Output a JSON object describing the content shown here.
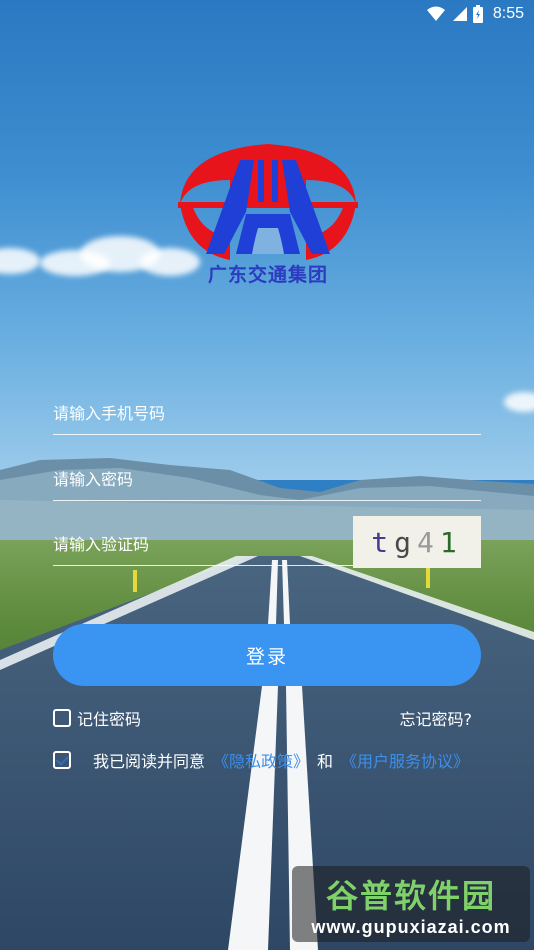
{
  "status_bar": {
    "time": "8:55",
    "icons": [
      "wifi-icon",
      "cell-signal-icon",
      "battery-icon"
    ]
  },
  "logo": {
    "text": "广东交通集团",
    "colors": {
      "ring": "#e8141b",
      "road": "#1f3fd6"
    }
  },
  "form": {
    "phone_placeholder": "请输入手机号码",
    "password_placeholder": "请输入密码",
    "captcha_placeholder": "请输入验证码",
    "captcha_chars": [
      "t",
      "g",
      "4",
      "1"
    ]
  },
  "login_button": {
    "label": "登录",
    "color": "#3a95f2"
  },
  "remember": {
    "label": "记住密码",
    "checked": false
  },
  "forgot": {
    "label": "忘记密码?"
  },
  "agreement": {
    "checked": true,
    "prefix": "我已阅读并同意",
    "privacy_link": "《隐私政策》",
    "and": "和",
    "terms_link": "《用户服务协议》"
  },
  "watermark": {
    "title": "谷普软件园",
    "url": "www.gupuxiazai.com"
  }
}
